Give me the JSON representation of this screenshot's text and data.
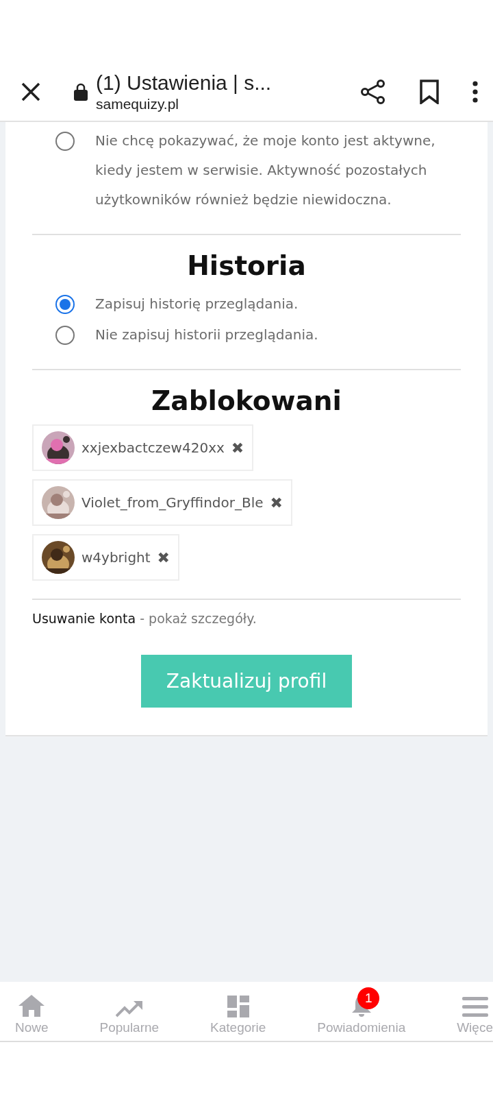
{
  "browser": {
    "title": "(1) Ustawienia | s...",
    "url": "samequizy.pl"
  },
  "activity_options": [
    {
      "label": "Nie chcę pokazywać, że moje konto jest aktywne, kiedy jestem w serwisie. Aktywność pozostałych użytkowników również będzie niewidoczna.",
      "selected": false
    }
  ],
  "history": {
    "title": "Historia",
    "options": [
      {
        "label": "Zapisuj historię przeglądania.",
        "selected": true
      },
      {
        "label": "Nie zapisuj historii przeglądania.",
        "selected": false
      }
    ]
  },
  "blocked": {
    "title": "Zablokowani",
    "users": [
      {
        "name": "xxjexbactczew420xx"
      },
      {
        "name": "Violet_from_Gryffindor_Ble"
      },
      {
        "name": "w4ybright"
      }
    ],
    "remove_symbol": "✖"
  },
  "delete_account": {
    "label": "Usuwanie konta",
    "link": "- pokaż szczegóły."
  },
  "submit_button": "Zaktualizuj profil",
  "bottom_nav": [
    {
      "kind": "home",
      "label": "Nowe"
    },
    {
      "kind": "trending",
      "label": "Popularne"
    },
    {
      "kind": "grid",
      "label": "Kategorie"
    },
    {
      "kind": "bell",
      "label": "Powiadomienia",
      "badge": "1"
    },
    {
      "kind": "menu",
      "label": "Więce"
    }
  ]
}
